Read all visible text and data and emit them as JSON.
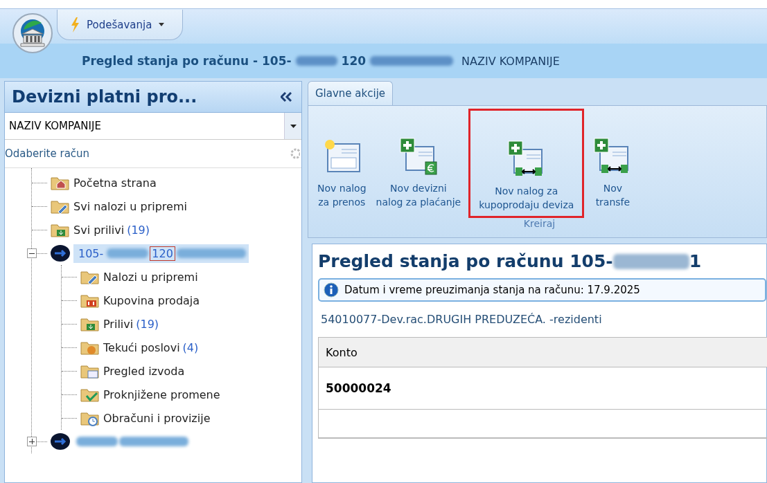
{
  "app_menu": {
    "label": "Podešavanja"
  },
  "title_bar": {
    "title": "Pregled stanja po računu -",
    "account_prefix": "105-",
    "account_mark": "120",
    "company": "NAZIV KOMPANIJE"
  },
  "sidebar": {
    "title": "Devizni platni pro...",
    "company_select": {
      "value": "NAZIV KOMPANIJE"
    },
    "account_label": "Odaberite račun",
    "tree": [
      {
        "kind": "home",
        "label": "Početna strana"
      },
      {
        "kind": "edit",
        "label": "Svi nalozi u pripremi"
      },
      {
        "kind": "inbox",
        "label": "Svi prilivi",
        "count": "(19)"
      },
      {
        "kind": "account",
        "prefix": "105-",
        "mark": "120",
        "mark_boxed": true,
        "selected": true,
        "expanded": true,
        "children": [
          {
            "kind": "edit",
            "label": "Nalozi u pripremi"
          },
          {
            "kind": "exchange",
            "label": "Kupovina prodaja"
          },
          {
            "kind": "inbox",
            "label": "Prilivi",
            "count": "(19)"
          },
          {
            "kind": "running",
            "label": "Tekući poslovi",
            "count": "(4)"
          },
          {
            "kind": "statement",
            "label": "Pregled izvoda"
          },
          {
            "kind": "check",
            "label": "Proknjižene promene"
          },
          {
            "kind": "clock",
            "label": "Obračuni i provizije"
          }
        ]
      },
      {
        "kind": "account",
        "selected": false,
        "expanded": false
      }
    ]
  },
  "ribbon": {
    "tabs": [
      {
        "label": "Glavne akcije",
        "selected": true
      }
    ],
    "group": {
      "label": "Kreiraj",
      "buttons": [
        {
          "kind": "new",
          "lines": [
            "Nov nalog",
            "za prenos"
          ],
          "highlighted": false
        },
        {
          "kind": "euro",
          "lines": [
            "Nov devizni",
            "nalog za plaćanje"
          ],
          "highlighted": false
        },
        {
          "kind": "exchange",
          "lines": [
            "Nov nalog za",
            "kupoprodaju deviza"
          ],
          "highlighted": true
        },
        {
          "kind": "transfer",
          "lines": [
            "Nov",
            "transfe"
          ],
          "highlighted": false
        }
      ]
    }
  },
  "content": {
    "heading_prefix": "Pregled stanja po računu 105-",
    "heading_tail": "1",
    "info": "Datum i vreme preuzimanja stanja na računu: 17.9.2025",
    "account_type": "54010077-Dev.rac.DRUGIH PREDUZEĆA. -rezidenti",
    "table": {
      "columns": [
        "Konto"
      ],
      "rows": [
        [
          "50000024"
        ]
      ]
    }
  }
}
